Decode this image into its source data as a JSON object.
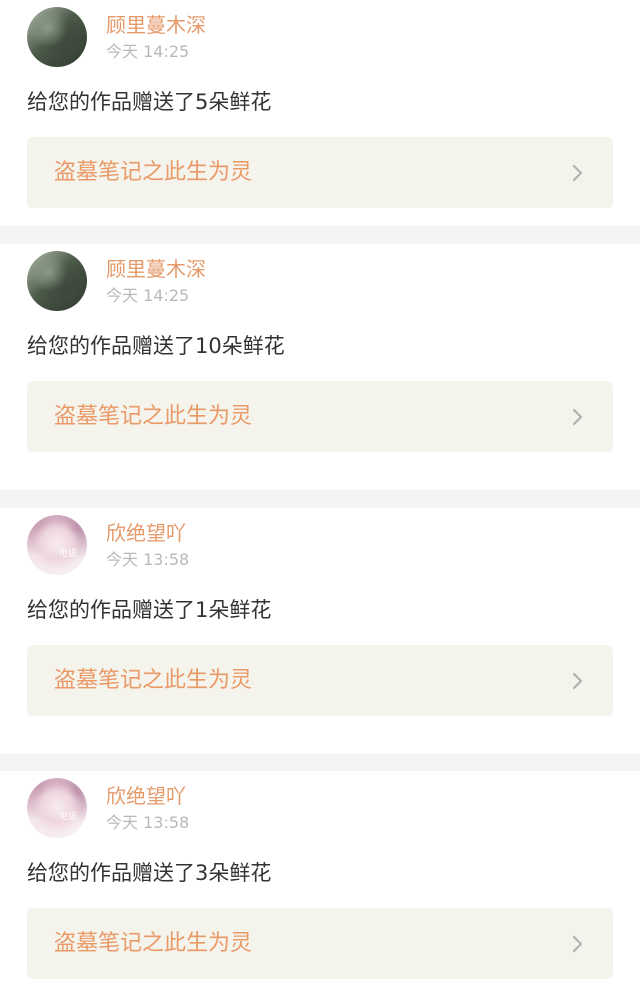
{
  "notifications": [
    {
      "user_name": "顾里蔓木深",
      "time": "今天 14:25",
      "message": "给您的作品赠送了5朵鲜花",
      "work_title": "盗墓笔记之此生为灵",
      "avatar_style": "dark",
      "avatar_tag": ""
    },
    {
      "user_name": "顾里蔓木深",
      "time": "今天 14:25",
      "message": "给您的作品赠送了10朵鲜花",
      "work_title": "盗墓笔记之此生为灵",
      "avatar_style": "dark",
      "avatar_tag": ""
    },
    {
      "user_name": "欣绝望吖",
      "time": "今天 13:58",
      "message": "给您的作品赠送了1朵鲜花",
      "work_title": "盗墓笔记之此生为灵",
      "avatar_style": "cat",
      "avatar_tag": "电锯"
    },
    {
      "user_name": "欣绝望吖",
      "time": "今天 13:58",
      "message": "给您的作品赠送了3朵鲜花",
      "work_title": "盗墓笔记之此生为灵",
      "avatar_style": "cat",
      "avatar_tag": "电锯"
    }
  ],
  "icons": {
    "chevron": "chevron-right-icon"
  },
  "colors": {
    "username": "#e59a6a",
    "work_title": "#ea9a66",
    "link_background": "#f4f3ec",
    "timestamp": "#b9b9b9"
  }
}
